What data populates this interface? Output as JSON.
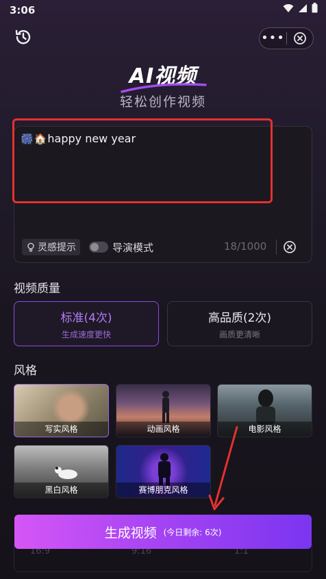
{
  "status_bar": {
    "time": "3:06"
  },
  "header": {
    "title": "AI视频",
    "subtitle": "轻松创作视频"
  },
  "prompt": {
    "emojis": [
      "🎆",
      "🏠"
    ],
    "text": "happy new year",
    "inspire_label": "灵感提示",
    "director_mode_label": "导演模式",
    "char_count": "18/1000"
  },
  "quality": {
    "title": "视频质量",
    "options": [
      {
        "label": "标准(4次)",
        "sub": "生成速度更快",
        "selected": true
      },
      {
        "label": "高品质(2次)",
        "sub": "画质更清晰",
        "selected": false
      }
    ]
  },
  "style": {
    "title": "风格",
    "items": [
      {
        "label": "写实风格",
        "selected": true
      },
      {
        "label": "动画风格",
        "selected": false
      },
      {
        "label": "电影风格",
        "selected": false
      },
      {
        "label": "黑白风格",
        "selected": false
      },
      {
        "label": "赛博朋克风格",
        "selected": false
      }
    ]
  },
  "generate": {
    "label": "生成视频",
    "remaining": "(今日剩余: 6次)"
  },
  "ratio_row": [
    "16:9",
    "9:16",
    "1:1"
  ],
  "colors": {
    "accent": "#9a5bf0",
    "annotation": "#e5312f"
  }
}
